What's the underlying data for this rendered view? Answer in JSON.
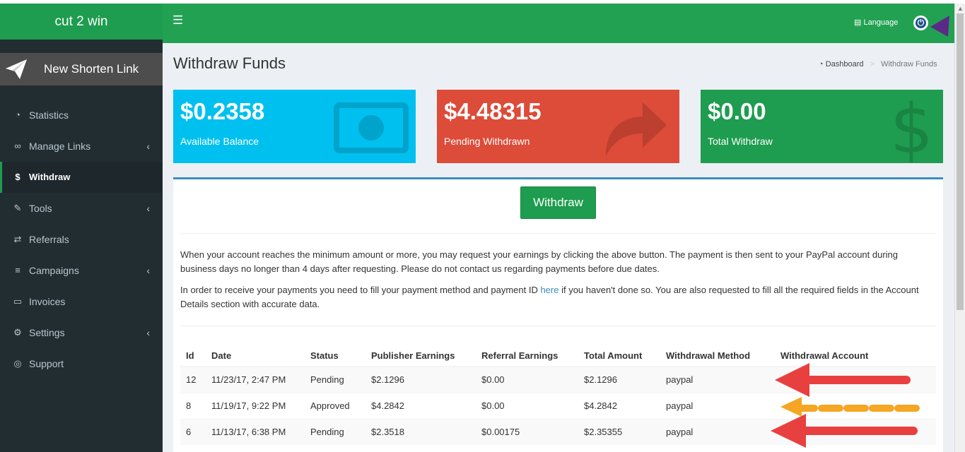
{
  "app": {
    "name": "cut 2 win"
  },
  "sidebar": {
    "new_link_label": "New Shorten Link",
    "items": [
      {
        "label": "Statistics",
        "icon": "dashboard-icon",
        "has_children": false,
        "active": false
      },
      {
        "label": "Manage Links",
        "icon": "link-icon",
        "has_children": true,
        "active": false
      },
      {
        "label": "Withdraw",
        "icon": "dollar-icon",
        "has_children": false,
        "active": true
      },
      {
        "label": "Tools",
        "icon": "wrench-icon",
        "has_children": true,
        "active": false
      },
      {
        "label": "Referrals",
        "icon": "exchange-icon",
        "has_children": false,
        "active": false
      },
      {
        "label": "Campaigns",
        "icon": "database-icon",
        "has_children": true,
        "active": false
      },
      {
        "label": "Invoices",
        "icon": "credit-card-icon",
        "has_children": false,
        "active": false
      },
      {
        "label": "Settings",
        "icon": "cogs-icon",
        "has_children": true,
        "active": false
      },
      {
        "label": "Support",
        "icon": "life-ring-icon",
        "has_children": false,
        "active": false
      }
    ]
  },
  "header": {
    "language_label": "Language"
  },
  "page": {
    "title": "Withdraw Funds",
    "breadcrumb": {
      "home": "Dashboard",
      "current": "Withdraw Funds"
    }
  },
  "stats": {
    "available": {
      "amount": "$0.2358",
      "label": "Available Balance",
      "color": "#00c0ef"
    },
    "pending": {
      "amount": "$4.48315",
      "label": "Pending Withdrawn",
      "color": "#dd4b39"
    },
    "total": {
      "amount": "$0.00",
      "label": "Total Withdraw",
      "color": "#1e9c4f"
    }
  },
  "panel": {
    "withdraw_button": "Withdraw",
    "para1": "When your account reaches the minimum amount or more, you may request your earnings by clicking the above button. The payment is then sent to your PayPal account during business days no longer than 4 days after requesting. Please do not contact us regarding payments before due dates.",
    "para2_before": "In order to receive your payments you need to fill your payment method and payment ID ",
    "para2_link": "here",
    "para2_after": " if you haven't done so. You are also requested to fill all the required fields in the Account Details section with accurate data."
  },
  "table": {
    "headers": [
      "Id",
      "Date",
      "Status",
      "Publisher Earnings",
      "Referral Earnings",
      "Total Amount",
      "Withdrawal Method",
      "Withdrawal Account"
    ],
    "rows": [
      {
        "id": "12",
        "date": "11/23/17, 2:47 PM",
        "status": "Pending",
        "publisher": "$2.1296",
        "referral": "$0.00",
        "total": "$2.1296",
        "method": "paypal",
        "account": ""
      },
      {
        "id": "8",
        "date": "11/19/17, 9:22 PM",
        "status": "Approved",
        "publisher": "$4.2842",
        "referral": "$0.00",
        "total": "$4.2842",
        "method": "paypal",
        "account": ""
      },
      {
        "id": "6",
        "date": "11/13/17, 6:38 PM",
        "status": "Pending",
        "publisher": "$2.3518",
        "referral": "$0.00175",
        "total": "$2.35355",
        "method": "paypal",
        "account": ""
      }
    ]
  },
  "annotations": {
    "arrow_colors": [
      "#e8403f",
      "#f5a623",
      "#e8403f",
      "#5b2a86"
    ]
  }
}
